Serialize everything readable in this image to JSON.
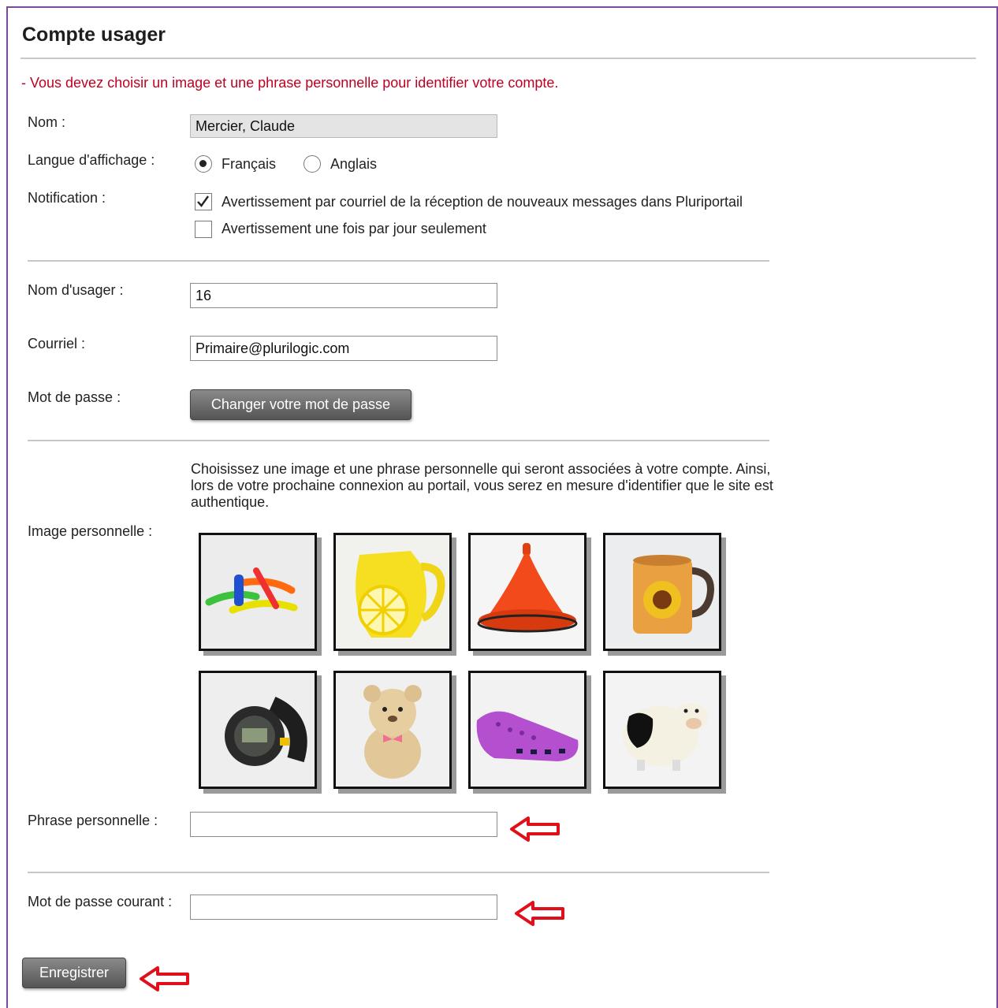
{
  "page": {
    "title": "Compte usager",
    "error_message": "- Vous devez choisir un image et une phrase personnelle pour identifier votre compte."
  },
  "form": {
    "name_label": "Nom :",
    "name_value": "Mercier, Claude",
    "language_label": "Langue d'affichage :",
    "language_options": [
      {
        "label": "Français",
        "checked": true
      },
      {
        "label": "Anglais",
        "checked": false
      }
    ],
    "notification_label": "Notification :",
    "notification_options": [
      {
        "label": "Avertissement par courriel de la réception de nouveaux messages dans Pluriportail",
        "checked": true
      },
      {
        "label": "Avertissement une fois par jour seulement",
        "checked": false
      }
    ],
    "username_label": "Nom d'usager :",
    "username_value": "16",
    "email_label": "Courriel :",
    "email_value": "Primaire@plurilogic.com",
    "password_label": "Mot de passe :",
    "change_password_button": "Changer votre mot de passe",
    "image_description": "Choisissez une image et une phrase personnelle qui seront associées à votre compte. Ainsi, lors de votre prochaine connexion au portail, vous serez en mesure d'identifier que le site est authentique.",
    "image_label": "Image personnelle :",
    "images": [
      "plastic-toys-image",
      "lemon-pitcher-image",
      "red-tajine-image",
      "sunflower-mug-image",
      "wristwatch-image",
      "teddy-bear-image",
      "purple-clog-image",
      "cow-figurine-image"
    ],
    "phrase_label": "Phrase personnelle :",
    "phrase_value": "",
    "current_password_label": "Mot de passe courant :",
    "current_password_value": "",
    "save_button": "Enregistrer"
  },
  "colors": {
    "frame_border": "#7a4a9c",
    "error_text": "#c00020",
    "annotation_arrow": "#e0101a"
  }
}
